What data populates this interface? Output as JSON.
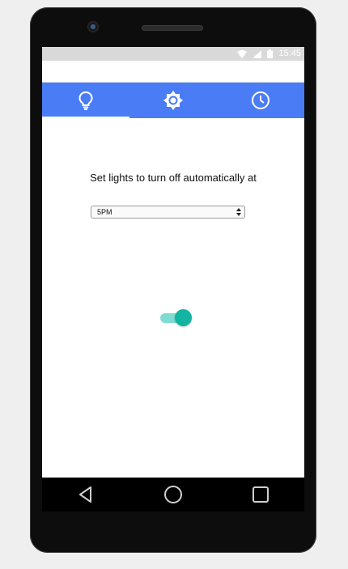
{
  "status_bar": {
    "time": "15:45",
    "icons": [
      "wifi-icon",
      "signal-icon",
      "battery-icon"
    ]
  },
  "tabs": [
    {
      "name": "lightbulb-icon",
      "active": true
    },
    {
      "name": "brightness-icon",
      "active": false
    },
    {
      "name": "clock-icon",
      "active": false
    }
  ],
  "main": {
    "label": "Set lights to turn off automatically at",
    "select_value": "5PM",
    "toggle_on": true
  },
  "nav": [
    "back-icon",
    "home-icon",
    "recents-icon"
  ],
  "colors": {
    "tabbar": "#4a7cf6",
    "toggle_knob": "#14b3a2",
    "toggle_track": "#7fdcd2"
  }
}
